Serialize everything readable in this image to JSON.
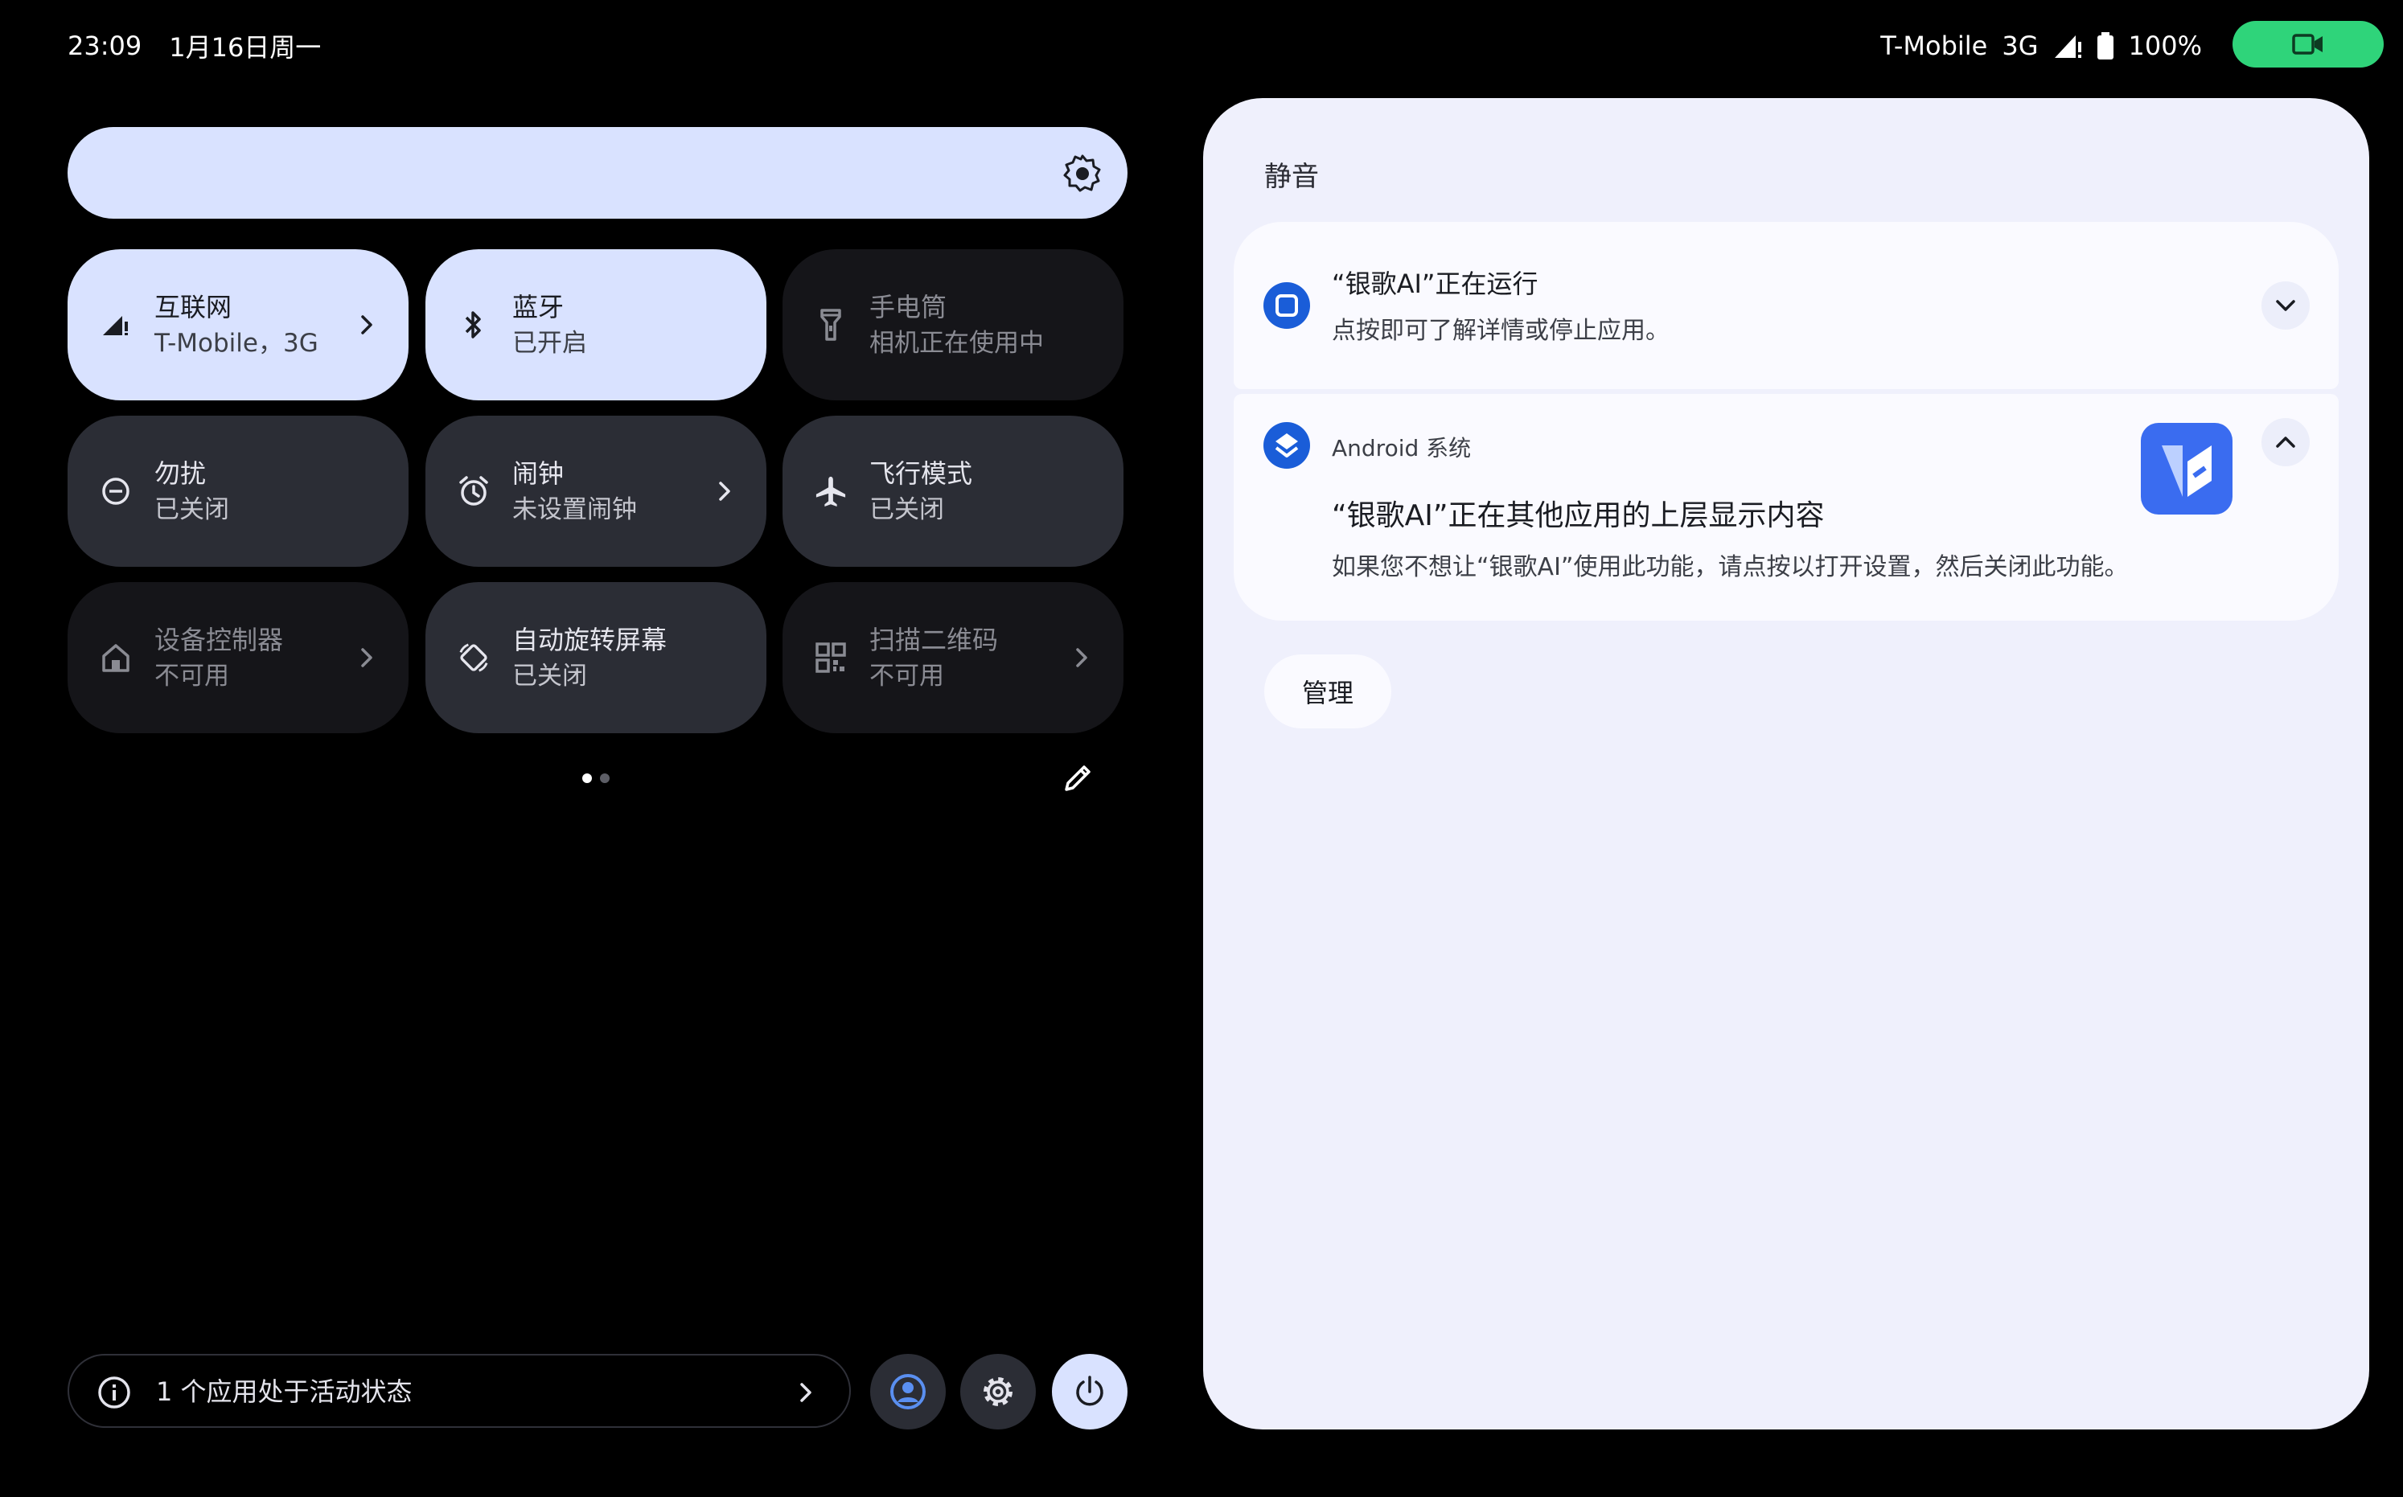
{
  "status_bar": {
    "time": "23:09",
    "date": "1月16日周一",
    "carrier": "T-Mobile",
    "network": "3G",
    "battery": "100%"
  },
  "quick_settings": {
    "tiles": [
      {
        "title": "互联网",
        "subtitle": "T-Mobile，3G",
        "state": "on",
        "icon": "signal-icon"
      },
      {
        "title": "蓝牙",
        "subtitle": "已开启",
        "state": "on",
        "icon": "bluetooth-icon"
      },
      {
        "title": "手电筒",
        "subtitle": "相机正在使用中",
        "state": "unavailable",
        "icon": "flashlight-icon"
      },
      {
        "title": "勿扰",
        "subtitle": "已关闭",
        "state": "off",
        "icon": "do-not-disturb-icon"
      },
      {
        "title": "闹钟",
        "subtitle": "未设置闹钟",
        "state": "off",
        "icon": "alarm-icon"
      },
      {
        "title": "飞行模式",
        "subtitle": "已关闭",
        "state": "off",
        "icon": "airplane-icon"
      },
      {
        "title": "设备控制器",
        "subtitle": "不可用",
        "state": "unavailable",
        "icon": "home-icon"
      },
      {
        "title": "自动旋转屏幕",
        "subtitle": "已关闭",
        "state": "off",
        "icon": "rotate-icon"
      },
      {
        "title": "扫描二维码",
        "subtitle": "不可用",
        "state": "unavailable",
        "icon": "qr-code-icon"
      }
    ],
    "active_apps": "1 个应用处于活动状态"
  },
  "notifications": {
    "section_label": "静音",
    "items": [
      {
        "title": "“银歌AI”正在运行",
        "text": "点按即可了解详情或停止应用。"
      },
      {
        "app": "Android 系统",
        "title": "“银歌AI”正在其他应用的上层显示内容",
        "text": "如果您不想让“银歌AI”使用此功能，请点按以打开设置，然后关闭此功能。"
      }
    ],
    "manage_label": "管理"
  },
  "colors": {
    "tile_on": "#d9e2ff",
    "tile_off": "#2b2d35",
    "panel_bg": "#eff0fc",
    "accent_blue": "#1a5dd8",
    "record_green": "#2fd47a"
  }
}
